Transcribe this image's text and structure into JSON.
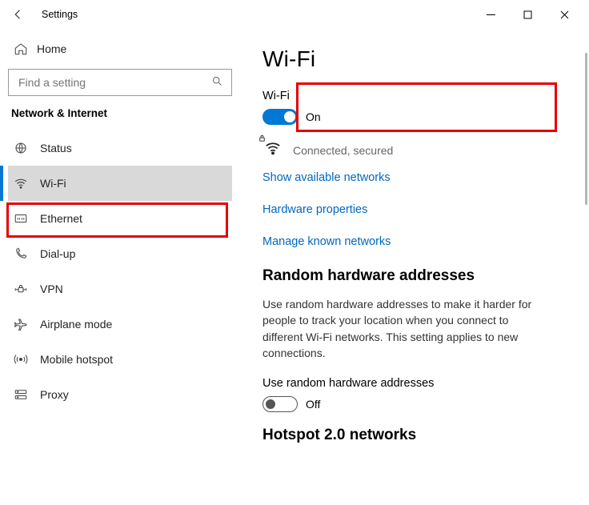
{
  "window": {
    "title": "Settings"
  },
  "sidebar": {
    "home": "Home",
    "search_placeholder": "Find a setting",
    "section": "Network & Internet",
    "items": [
      {
        "icon": "status-icon",
        "label": "Status"
      },
      {
        "icon": "wifi-icon",
        "label": "Wi-Fi"
      },
      {
        "icon": "ethernet-icon",
        "label": "Ethernet"
      },
      {
        "icon": "dialup-icon",
        "label": "Dial-up"
      },
      {
        "icon": "vpn-icon",
        "label": "VPN"
      },
      {
        "icon": "airplane-icon",
        "label": "Airplane mode"
      },
      {
        "icon": "hotspot-icon",
        "label": "Mobile hotspot"
      },
      {
        "icon": "proxy-icon",
        "label": "Proxy"
      }
    ]
  },
  "content": {
    "page_title": "Wi-Fi",
    "wifi_label": "Wi-Fi",
    "wifi_toggle_state": "On",
    "status_text": "Connected, secured",
    "links": {
      "show_networks": "Show available networks",
      "hw_props": "Hardware properties",
      "known_networks": "Manage known networks"
    },
    "random_section_title": "Random hardware addresses",
    "random_desc": "Use random hardware addresses to make it harder for people to track your location when you connect to different Wi-Fi networks. This setting applies to new connections.",
    "random_toggle_label": "Use random hardware addresses",
    "random_toggle_state": "Off",
    "hotspot_section_title": "Hotspot 2.0 networks"
  }
}
